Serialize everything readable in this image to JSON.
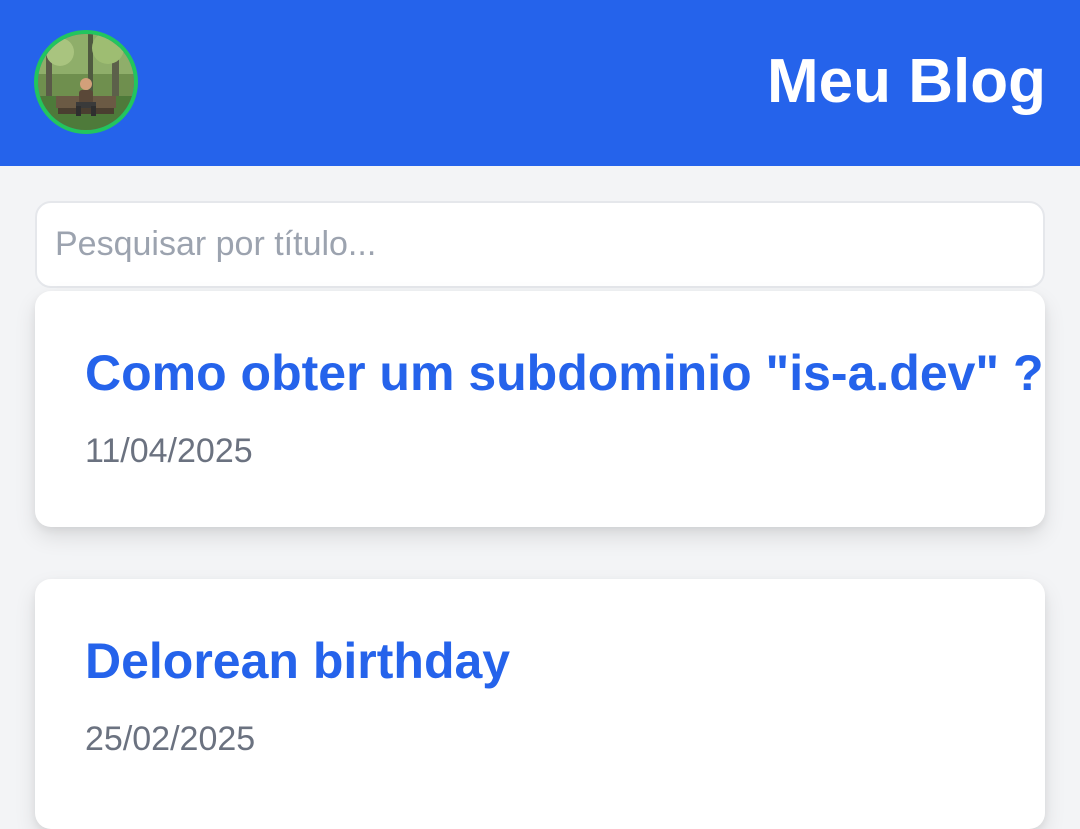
{
  "header": {
    "title": "Meu Blog",
    "background_color": "#2563eb",
    "avatar_icon": "profile-photo"
  },
  "search": {
    "placeholder": "Pesquisar por título...",
    "value": ""
  },
  "posts": [
    {
      "title": "Como obter um subdominio \"is-a.dev\" ?",
      "date": "11/04/2025"
    },
    {
      "title": "Delorean birthday",
      "date": "25/02/2025"
    }
  ],
  "colors": {
    "accent": "#2563eb",
    "avatar_border": "#22c55e",
    "page_background": "#f3f4f6",
    "date_text": "#6b7280"
  }
}
